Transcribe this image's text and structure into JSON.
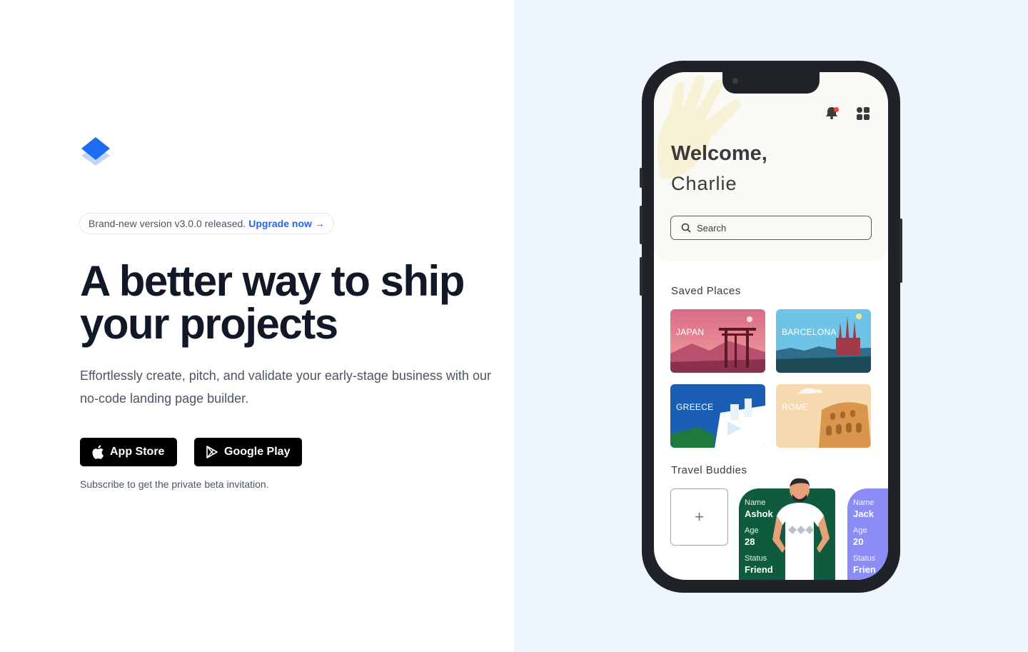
{
  "announcement": {
    "text": "Brand-new version v3.0.0 released.",
    "link": "Upgrade now →"
  },
  "hero": {
    "title_line1": "A better way to ship",
    "title_line2": "your projects",
    "subtitle": "Effortlessly create, pitch, and validate your early-stage business with our no-code landing page builder."
  },
  "buttons": {
    "app_store": "App Store",
    "google_play": "Google Play"
  },
  "beta_note": "Subscribe to get the private beta invitation.",
  "phone": {
    "welcome": "Welcome,",
    "username": "Charlie",
    "search_placeholder": "Search",
    "saved_places_title": "Saved Places",
    "places": [
      {
        "name": "JAPAN"
      },
      {
        "name": "BARCELONA"
      },
      {
        "name": "GREECE"
      },
      {
        "name": "ROME"
      }
    ],
    "travel_buddies_title": "Travel Buddies",
    "add_label": "+",
    "buddies": [
      {
        "name_label": "Name",
        "name": "Ashok",
        "age_label": "Age",
        "age": "28",
        "status_label": "Status",
        "status": "Friend"
      },
      {
        "name_label": "Name",
        "name": "Jack",
        "age_label": "Age",
        "age": "20",
        "status_label": "Status",
        "status": "Frien"
      }
    ]
  },
  "colors": {
    "accent": "#2563eb",
    "right_bg": "#eef5ff",
    "buddy_green": "#0f5b3e",
    "buddy_purple": "#8b8cf5"
  },
  "icons": [
    "logo-icon",
    "apple-icon",
    "google-play-icon",
    "bell-icon",
    "grid-icon",
    "search-icon"
  ]
}
